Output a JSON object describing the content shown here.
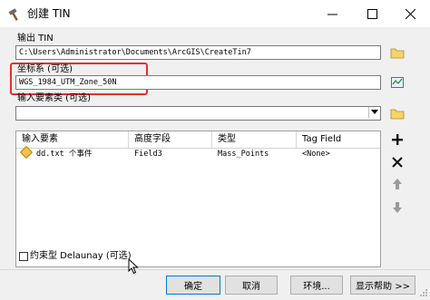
{
  "window": {
    "title": "创建 TIN"
  },
  "form": {
    "output_label": "输出 TIN",
    "output_value": "C:\\Users\\Administrator\\Documents\\ArcGIS\\CreateTin7",
    "crs_label": "坐标系 (可选)",
    "crs_value": "WGS_1984_UTM_Zone_50N",
    "input_label": "输入要素类 (可选)",
    "input_value": ""
  },
  "table": {
    "columns": [
      "输入要素",
      "高度字段",
      "类型",
      "Tag Field"
    ],
    "rows": [
      {
        "feature": "dd.txt 个事件",
        "height": "Field3",
        "type": "Mass_Points",
        "tag": "<None>"
      }
    ]
  },
  "constrained": {
    "label": "约束型 Delaunay (可选)",
    "checked": false
  },
  "buttons": {
    "ok": "确定",
    "cancel": "取消",
    "env": "环境...",
    "help": "显示帮助 >>"
  },
  "accent": {
    "highlight": "#e23030",
    "focus": "#0078d7"
  }
}
